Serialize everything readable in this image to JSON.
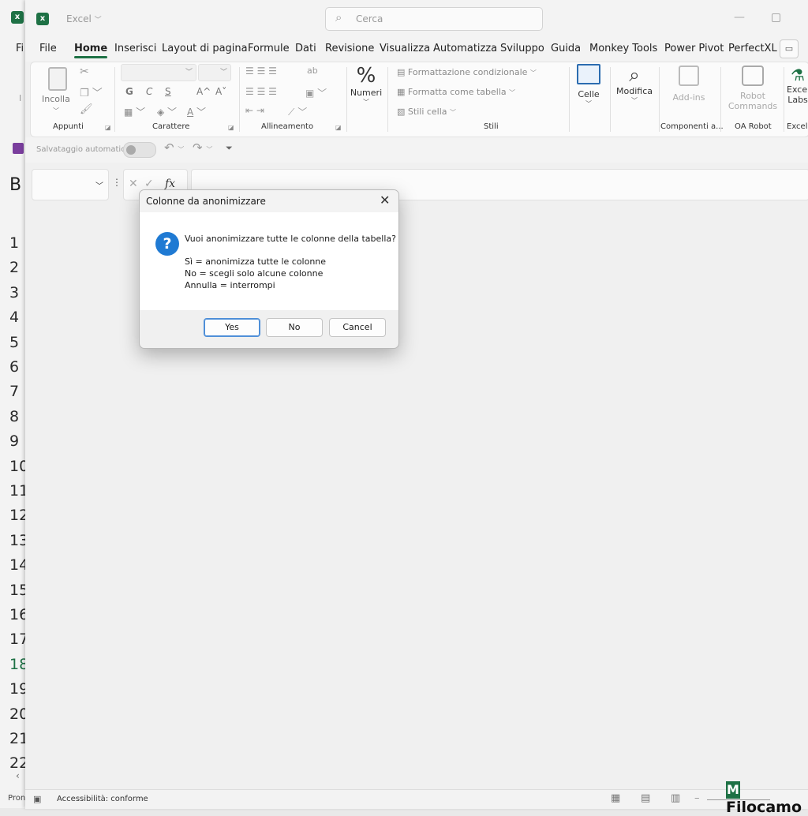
{
  "app": {
    "name": "Excel",
    "search_placeholder": "Cerca"
  },
  "background_window": {
    "label_top": "Fi",
    "label_cell": "B",
    "label_ribbon": "I",
    "row_numbers": [
      "1",
      "2",
      "3",
      "4",
      "5",
      "6",
      "7",
      "8",
      "9",
      "10",
      "11",
      "12",
      "13",
      "14",
      "15",
      "16",
      "17",
      "18",
      "19",
      "20",
      "21",
      "22"
    ],
    "selected_row": "18",
    "status_text": "Pron"
  },
  "ribbon_tabs": [
    "File",
    "Home",
    "Inserisci",
    "Layout di pagina",
    "Formule",
    "Dati",
    "Revisione",
    "Visualizza",
    "Automatizza",
    "Sviluppo",
    "Guida",
    "Monkey Tools",
    "Power Pivot",
    "PerfectXL"
  ],
  "active_tab": "Home",
  "ribbon": {
    "paste_label": "Incolla",
    "group_appunti": "Appunti",
    "group_carattere": "Carattere",
    "bold": "G",
    "italic": "C",
    "underline": "S",
    "grow_font": "A^",
    "shrink_font": "A˅",
    "font_color_letter": "A",
    "group_allineamento": "Allineamento",
    "numeri": "Numeri",
    "formattazione_condizionale": "Formattazione condizionale",
    "formatta_come_tabella": "Formatta come tabella",
    "stili_cella": "Stili cella",
    "group_stili": "Stili",
    "celle": "Celle",
    "modifica": "Modifica",
    "addins": "Add-ins",
    "group_componenti": "Componenti a...",
    "robot_commands_1": "Robot",
    "robot_commands_2": "Commands",
    "group_oa_robot": "OA Robot",
    "excel_labs_1": "Excel",
    "excel_labs_2": "Labs",
    "group_excel_labs": "Excel Labs"
  },
  "qat": {
    "autosave": "Salvataggio automatico"
  },
  "formula_bar": {
    "fx": "fx"
  },
  "status_bar": {
    "accessibility": "Accessibilità: conforme"
  },
  "watermark": "Filocamo",
  "dialog": {
    "title": "Colonne da anonimizzare",
    "question": "Vuoi anonimizzare tutte le colonne della tabella?",
    "line_yes": "Sì = anonimizza tutte le colonne",
    "line_no": "No = scegli solo alcune colonne",
    "line_cancel": "Annulla = interrompi",
    "buttons": {
      "yes": "Yes",
      "no": "No",
      "cancel": "Cancel"
    }
  },
  "colors": {
    "accent": "#1e7145",
    "info_icon": "#1f7ad3"
  }
}
